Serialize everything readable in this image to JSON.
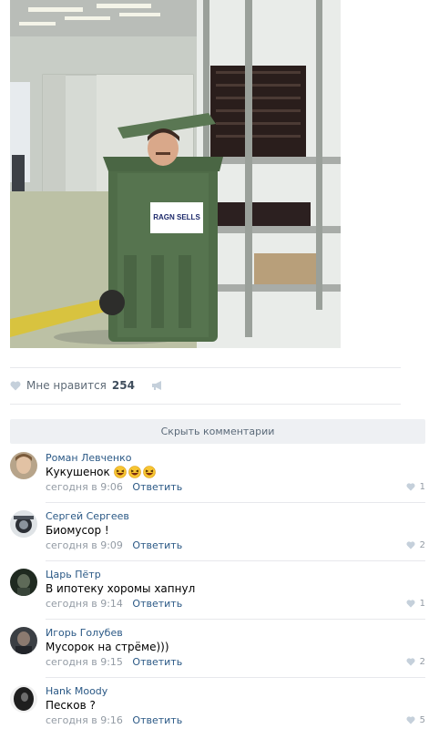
{
  "post": {
    "photo_sign_text": "RAGN SELLS"
  },
  "likes": {
    "label": "Мне нравится",
    "count": "254"
  },
  "comments_section": {
    "hide_label": "Скрыть комментарии",
    "comments": [
      {
        "author": "Роман Левченко",
        "text": "Кукушенок",
        "emoji_count": 3,
        "date": "сегодня в 9:06",
        "reply_label": "Ответить",
        "likes": "1"
      },
      {
        "author": "Сергей Сергеев",
        "text": "Биомусор !",
        "emoji_count": 0,
        "date": "сегодня в 9:09",
        "reply_label": "Ответить",
        "likes": "2"
      },
      {
        "author": "Царь Пётр",
        "text": "В ипотеку хоромы хапнул",
        "emoji_count": 0,
        "date": "сегодня в 9:14",
        "reply_label": "Ответить",
        "likes": "1"
      },
      {
        "author": "Игорь Голубев",
        "text": "Мусорок на стрёме)))",
        "emoji_count": 0,
        "date": "сегодня в 9:15",
        "reply_label": "Ответить",
        "likes": "2"
      },
      {
        "author": "Hank Moody",
        "text": "Песков ?",
        "emoji_count": 0,
        "date": "сегодня в 9:16",
        "reply_label": "Ответить",
        "likes": "5"
      }
    ]
  },
  "colors": {
    "link": "#2a5885",
    "muted": "#939ba4",
    "heart": "#c5d0db",
    "bin_green": "#4d6a47"
  },
  "icons": {
    "like": "heart-icon",
    "share": "megaphone-icon",
    "emoji": "laughing-emoji-icon"
  }
}
